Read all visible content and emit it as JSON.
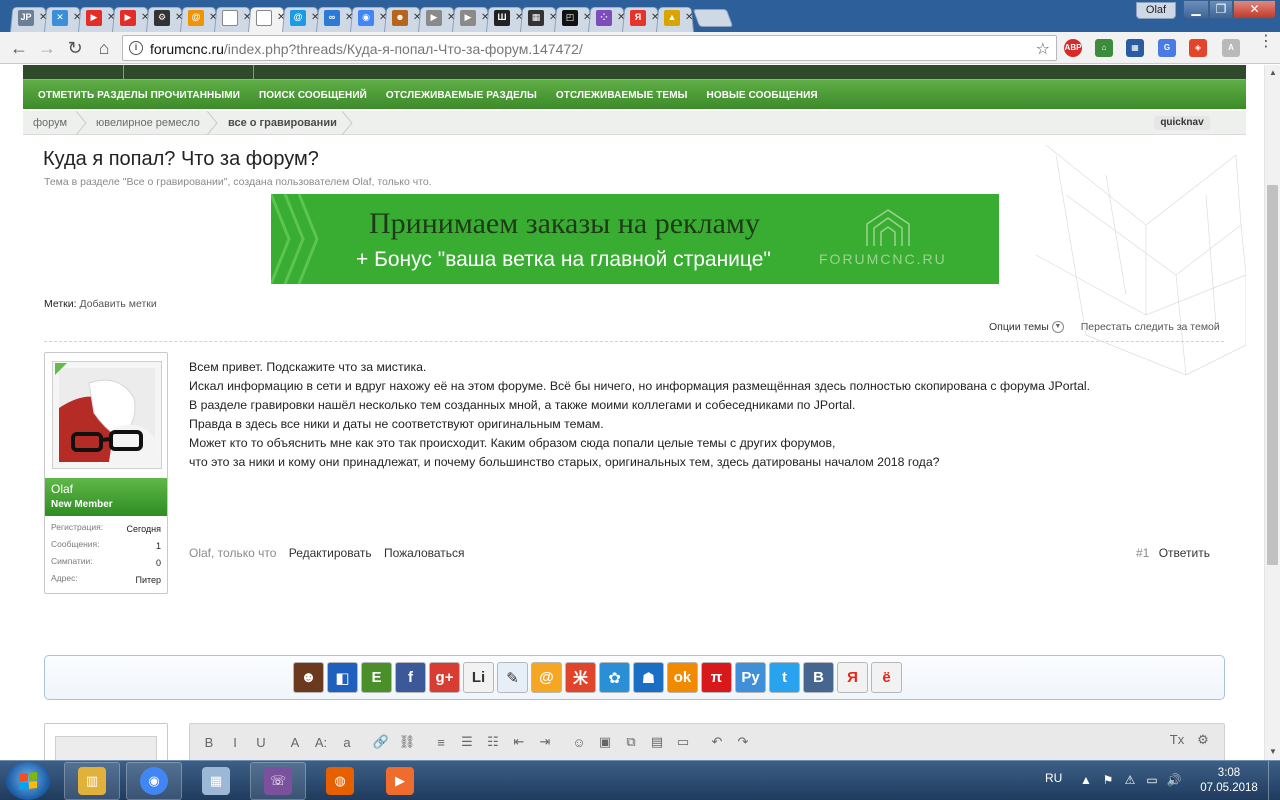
{
  "browser": {
    "tabs": [
      {
        "icon": "jp-favicon",
        "label": "JP",
        "color": "#6b7f96"
      },
      {
        "icon": "puzzle-favicon",
        "label": "✕",
        "color": "#3a8fd6"
      },
      {
        "icon": "youtube-favicon",
        "label": "▶",
        "color": "#e52d27"
      },
      {
        "icon": "youtube-favicon",
        "label": "▶",
        "color": "#e52d27"
      },
      {
        "icon": "gear-favicon",
        "label": "⚙",
        "color": "#333333"
      },
      {
        "icon": "at-favicon",
        "label": "@",
        "color": "#f29400"
      },
      {
        "icon": "document-favicon",
        "label": "",
        "color": "#ffffff"
      },
      {
        "icon": "document-favicon",
        "label": "",
        "color": "#ffffff"
      },
      {
        "icon": "at-favicon",
        "label": "@",
        "color": "#1a9be6"
      },
      {
        "icon": "infinity-favicon",
        "label": "∞",
        "color": "#2b7bd6"
      },
      {
        "icon": "chrome-favicon",
        "label": "◉",
        "color": "#4285f4"
      },
      {
        "icon": "person-favicon",
        "label": "☻",
        "color": "#b5651d"
      },
      {
        "icon": "video-favicon",
        "label": "▶",
        "color": "#8a8a8a"
      },
      {
        "icon": "video-favicon",
        "label": "▶",
        "color": "#8a8a8a"
      },
      {
        "icon": "building-favicon",
        "label": "Ш",
        "color": "#222222"
      },
      {
        "icon": "photo-favicon",
        "label": "▦",
        "color": "#333333"
      },
      {
        "icon": "cube-favicon",
        "label": "◰",
        "color": "#111111"
      },
      {
        "icon": "dots-favicon",
        "label": "⁘",
        "color": "#7c4dbb"
      },
      {
        "icon": "yandex-favicon",
        "label": "Я",
        "color": "#e8332a"
      },
      {
        "icon": "mountain-favicon",
        "label": "▲",
        "color": "#d9a400"
      }
    ],
    "active_tab_index": 7,
    "user": "Olaf",
    "window_controls": {
      "minimize": "▁",
      "maximize": "❐",
      "close": "✕"
    },
    "toolbar": {
      "back": "←",
      "forward": "→",
      "reload": "↻",
      "home": "⌂"
    },
    "url_host": "forumcnc.ru",
    "url_path": "/index.php?threads/Куда-я-попал-Что-за-форум.147472/",
    "extensions": [
      {
        "name": "adblock-plus-icon",
        "label": "ABP",
        "color": "#d72a2a"
      },
      {
        "name": "house-extension-icon",
        "label": "⌂",
        "color": "#3c8c3c"
      },
      {
        "name": "color-picker-icon",
        "label": "▦",
        "color": "#2a5d9f"
      },
      {
        "name": "translate-icon",
        "label": "G",
        "color": "#4a7be5"
      },
      {
        "name": "shield-extension-icon",
        "label": "◈",
        "color": "#e2452b"
      },
      {
        "name": "pdf-extension-icon",
        "label": "A",
        "color": "#b9b9b9"
      }
    ],
    "menu": "⋮"
  },
  "nav": {
    "links": [
      "Отметить разделы прочитанными",
      "Поиск сообщений",
      "Отслеживаемые разделы",
      "Отслеживаемые темы",
      "Новые сообщения"
    ]
  },
  "breadcrumbs": {
    "items": [
      "форум",
      "ювелирное ремесло",
      "все о гравировании"
    ],
    "quicknav": "quicknav"
  },
  "thread": {
    "title": "Куда я попал? Что за форум?",
    "description": "Тема в разделе \"Все о гравировании\", создана пользователем Olaf, только что."
  },
  "banner": {
    "line1": "Принимаем заказы на рекламу",
    "line2": "+ Бонус \"ваша ветка на главной странице\"",
    "brand": "FORUMCNC.RU"
  },
  "tags": {
    "label": "Метки:",
    "add": "Добавить метки"
  },
  "thread_tools": {
    "options": "Опции темы",
    "unwatch": "Перестать следить за темой"
  },
  "post": {
    "user": {
      "name": "Olaf",
      "title": "New Member",
      "stats": [
        {
          "key": "Регистрация:",
          "value": "Сегодня"
        },
        {
          "key": "Сообщения:",
          "value": "1"
        },
        {
          "key": "Симпатии:",
          "value": "0"
        },
        {
          "key": "Адрес:",
          "value": "Питер"
        }
      ]
    },
    "lines": [
      "Всем привет. Подскажите что за мистика.",
      "Искал информацию в сети и вдруг нахожу её на этом форуме. Всё бы ничего, но информация размещённая здесь полностью скопирована с форума JPortal.",
      "В разделе гравировки нашёл несколько тем созданных мной, а также моими коллегами и собеседниками по JPortal.",
      "Правда в здесь все ники и даты не соответствуют оригинальным темам.",
      "Может кто то объяснить мне как это так происходит. Каким образом сюда попали целые темы с других форумов,",
      "что это за ники и кому они принадлежат, и почему большинство старых, оригинальных тем, здесь датированы началом 2018 года?"
    ],
    "author_line": "Olaf, только что",
    "edit": "Редактировать",
    "report": "Пожаловаться",
    "number": "#1",
    "reply": "Ответить"
  },
  "share": [
    {
      "name": "memori-icon",
      "label": "☻",
      "color": "#6b3a1e"
    },
    {
      "name": "delicious-icon",
      "label": "◧",
      "color": "#1f5fbd"
    },
    {
      "name": "evernote-icon",
      "label": "E",
      "color": "#4a8f2a"
    },
    {
      "name": "facebook-icon",
      "label": "f",
      "color": "#3b5998"
    },
    {
      "name": "google-plus-icon",
      "label": "g+",
      "color": "#d73d32"
    },
    {
      "name": "linkedin-icon",
      "label": "Li",
      "color": "#f2f2f2"
    },
    {
      "name": "livejournal-icon",
      "label": "✎",
      "color": "#e6eef7"
    },
    {
      "name": "mail-ru-icon",
      "label": "@",
      "color": "#f5a623"
    },
    {
      "name": "moikrug-icon",
      "label": "米",
      "color": "#e0452b"
    },
    {
      "name": "myspace-icon",
      "label": "✿",
      "color": "#2b8fd6"
    },
    {
      "name": "my-world-icon",
      "label": "☗",
      "color": "#1a6fc4"
    },
    {
      "name": "odnoklassniki-icon",
      "label": "ok",
      "color": "#f28a00"
    },
    {
      "name": "pinme-icon",
      "label": "π",
      "color": "#d7191c"
    },
    {
      "name": "pikabu-icon",
      "label": "Py",
      "color": "#3f8fd9"
    },
    {
      "name": "twitter-icon",
      "label": "t",
      "color": "#2aa3ef"
    },
    {
      "name": "vkontakte-icon",
      "label": "B",
      "color": "#45668e"
    },
    {
      "name": "yandex-share-icon",
      "label": "Я",
      "color": "#f2f2f2"
    },
    {
      "name": "yo-icon",
      "label": "ё",
      "color": "#f2f2f2"
    }
  ],
  "editor": {
    "tools": [
      "B",
      "I",
      "U",
      "A",
      "A:",
      "a",
      "🔗",
      "⛓",
      "≡",
      "☰",
      "☷",
      "⇤",
      "⇥",
      "☺",
      "▣",
      "⧉",
      "▤",
      "▭",
      "↶",
      "↷"
    ],
    "right_tools": [
      "Tx",
      "⚙"
    ]
  },
  "taskbar": {
    "apps": [
      {
        "name": "explorer-app",
        "label": "▥",
        "color": "#e2b13c"
      },
      {
        "name": "chrome-app",
        "label": "◉",
        "color": "#4285f4"
      },
      {
        "name": "calculator-app",
        "label": "▦",
        "color": "#9db8d6"
      },
      {
        "name": "viber-app",
        "label": "☏",
        "color": "#7b519d"
      },
      {
        "name": "firefox-app",
        "label": "◍",
        "color": "#e66000"
      },
      {
        "name": "media-player-app",
        "label": "▶",
        "color": "#ef6c2d"
      }
    ],
    "lang": "RU",
    "tray": [
      "▲",
      "⚑",
      "⚠",
      "▭",
      "🔊"
    ],
    "time": "3:08",
    "date": "07.05.2018"
  }
}
